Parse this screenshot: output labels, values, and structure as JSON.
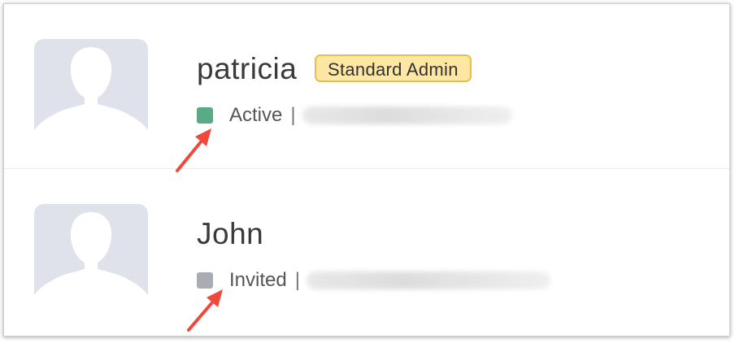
{
  "users": [
    {
      "name": "patricia",
      "role_badge": "Standard Admin",
      "status": "Active",
      "separator": "|",
      "email": "",
      "status_color": "#5aaa85"
    },
    {
      "name": "John",
      "role_badge": "",
      "status": "Invited",
      "separator": "|",
      "email": "",
      "status_color": "#a9adb3"
    }
  ],
  "annotation_color": "#f0483c",
  "icons": {
    "avatar": "user-silhouette-icon",
    "annotation": "red-arrow-icon"
  }
}
